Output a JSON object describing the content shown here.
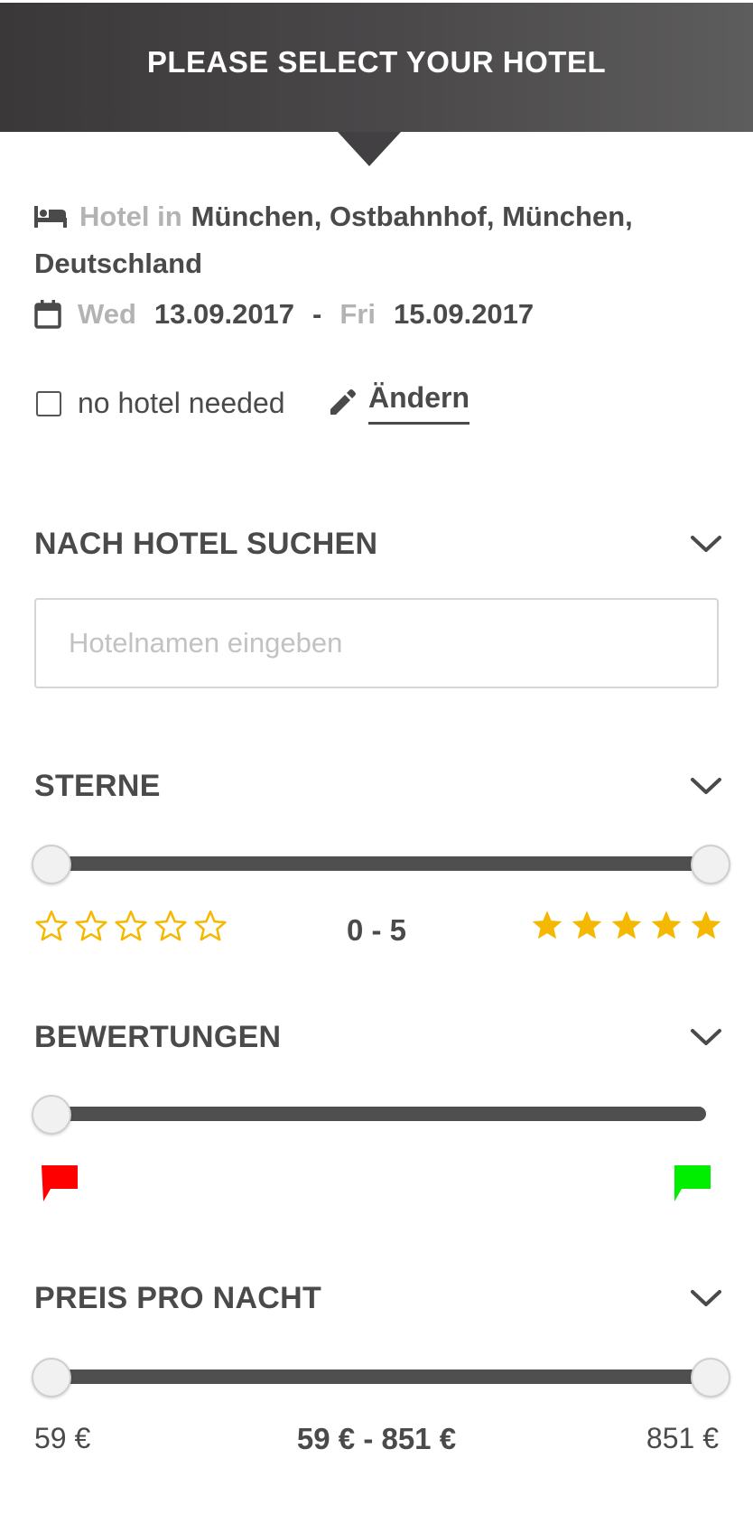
{
  "header": {
    "title": "PLEASE SELECT YOUR HOTEL"
  },
  "hotel_info": {
    "prefix": "Hotel in",
    "location": "München, Ostbahnhof, München,",
    "location_line2": "Deutschland",
    "checkin_day": "Wed",
    "checkin_date": "13.09.2017",
    "separator": "-",
    "checkout_day": "Fri",
    "checkout_date": "15.09.2017"
  },
  "options": {
    "no_hotel_label": "no hotel needed",
    "no_hotel_checked": false,
    "edit_label": "Ändern"
  },
  "search_section": {
    "title": "NACH HOTEL SUCHEN",
    "placeholder": "Hotelnamen eingeben",
    "value": ""
  },
  "stars_section": {
    "title": "STERNE",
    "range_label": "0 - 5",
    "min": 0,
    "max": 5,
    "selected_min": 0,
    "selected_max": 5,
    "star_color": "#f5b800"
  },
  "ratings_section": {
    "title": "BEWERTUNGEN",
    "selected_min_fraction": 0,
    "low_flag_color": "#ff0000",
    "high_flag_color": "#00ee00"
  },
  "price_section": {
    "title": "PREIS PRO NACHT",
    "min_label": "59 €",
    "max_label": "851 €",
    "range_label": "59 € - 851 €",
    "selected_min": 59,
    "selected_max": 851
  },
  "icons": {
    "bed": "bed-icon",
    "calendar": "calendar-icon",
    "pencil": "pencil-icon",
    "chevron": "chevron-down-icon",
    "star_empty": "star-outline-icon",
    "star_full": "star-filled-icon",
    "flag": "flag-icon"
  }
}
